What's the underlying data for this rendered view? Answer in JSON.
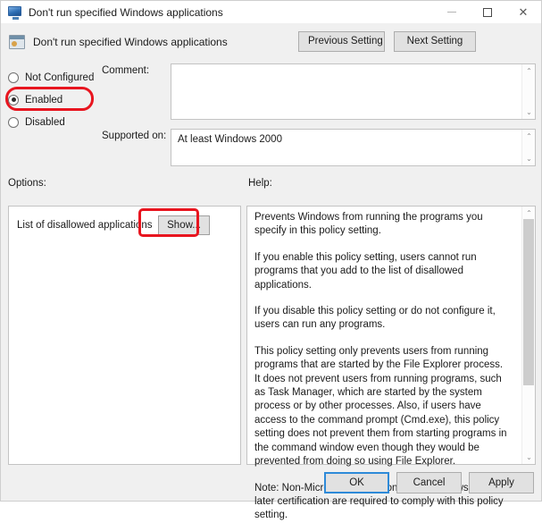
{
  "window": {
    "title": "Don't run specified Windows applications",
    "icon": "monitor-icon",
    "controls": {
      "minimize": "minimize-icon",
      "maximize": "maximize-icon",
      "close": "close-icon"
    }
  },
  "header": {
    "policy_icon": "policy-setting-icon",
    "policy_title": "Don't run specified Windows applications",
    "previous_setting_label": "Previous Setting",
    "next_setting_label": "Next Setting"
  },
  "states": {
    "options": [
      {
        "label": "Not Configured",
        "selected": false
      },
      {
        "label": "Enabled",
        "selected": true
      },
      {
        "label": "Disabled",
        "selected": false
      }
    ]
  },
  "comment": {
    "label": "Comment:",
    "value": "",
    "scroll_up": "⌃",
    "scroll_down": "⌄"
  },
  "supported": {
    "label": "Supported on:",
    "value": "At least Windows 2000",
    "scroll_up": "⌃",
    "scroll_down": "⌄"
  },
  "sections": {
    "options_label": "Options:",
    "help_label": "Help:"
  },
  "options_panel": {
    "item_label": "List of disallowed applications",
    "show_button_label": "Show..."
  },
  "help_panel": {
    "paragraphs": [
      "Prevents Windows from running the programs you specify in this policy setting.",
      "If you enable this policy setting, users cannot run programs that you add to the list of disallowed applications.",
      "If you disable this policy setting or do not configure it, users can run any programs.",
      "This policy setting only prevents users from running programs that are started by the File Explorer process. It does not prevent users from running programs, such as Task Manager, which are started by the system process or by other processes.  Also, if users have access to the command prompt (Cmd.exe), this policy setting does not prevent them from starting programs in the command window even though they would be prevented from doing so using File Explorer.",
      "Note: Non-Microsoft applications with Windows 2000 or later certification are required to comply with this policy setting."
    ],
    "scroll_up": "⌃",
    "scroll_down": "⌄"
  },
  "footer": {
    "ok_label": "OK",
    "cancel_label": "Cancel",
    "apply_label": "Apply"
  },
  "annotations": {
    "color": "#e8151f",
    "highlighted": [
      "Enabled",
      "Show..."
    ]
  }
}
